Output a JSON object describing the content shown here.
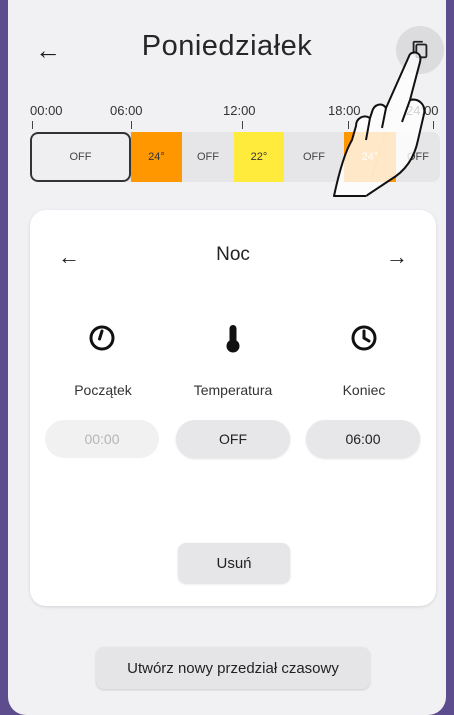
{
  "header": {
    "title": "Poniedziałek",
    "back_icon": "arrow-left-icon",
    "copy_icon": "copy-icon"
  },
  "timeline": {
    "ticks": [
      "00:00",
      "06:00",
      "12:00",
      "18:00",
      "24:00"
    ],
    "segments": [
      {
        "label": "OFF",
        "color": "#efeff1",
        "active": true
      },
      {
        "label": "24°",
        "color": "#ff9800"
      },
      {
        "label": "OFF",
        "color": "#e6e6e8"
      },
      {
        "label": "22°",
        "color": "#ffeb3b"
      },
      {
        "label": "OFF",
        "color": "#e6e6e8"
      },
      {
        "label": "24°",
        "color": "#ff9800"
      },
      {
        "label": "OFF",
        "color": "#e6e6e8"
      }
    ]
  },
  "card": {
    "period_name": "Noc",
    "start": {
      "label": "Początek",
      "value": "00:00",
      "icon": "clock-start-icon"
    },
    "temperature": {
      "label": "Temperatura",
      "value": "OFF",
      "icon": "thermometer-icon"
    },
    "end": {
      "label": "Koniec",
      "value": "06:00",
      "icon": "clock-end-icon"
    },
    "delete_label": "Usuń"
  },
  "footer": {
    "new_period_label": "Utwórz nowy przedział czasowy"
  },
  "colors": {
    "background": "#f1f0f3",
    "card": "#ffffff",
    "warm": "#ff9800",
    "mild": "#ffeb3b"
  }
}
